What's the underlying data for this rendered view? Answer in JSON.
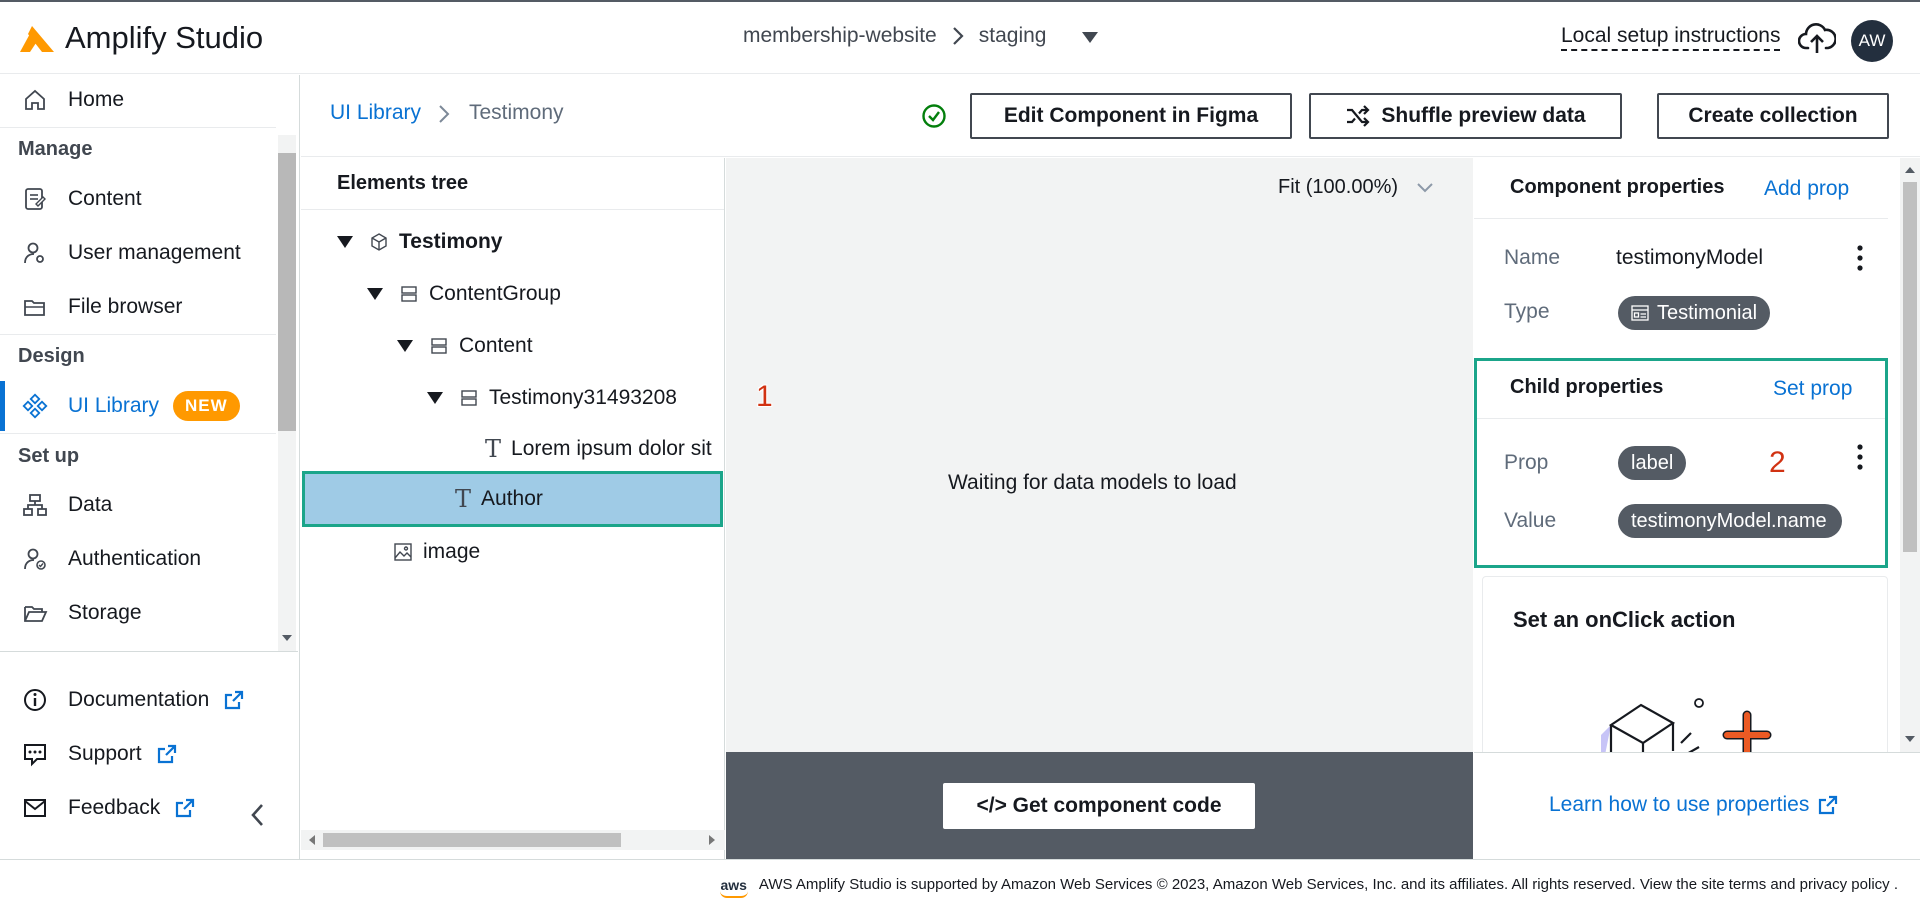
{
  "header": {
    "app_title": "Amplify Studio",
    "project": "membership-website",
    "environment": "staging",
    "setup_link": "Local setup instructions",
    "avatar_initials": "AW"
  },
  "sidebar": {
    "home": "Home",
    "sections": {
      "manage": "Manage",
      "design": "Design",
      "setup": "Set up"
    },
    "manage_items": [
      "Content",
      "User management",
      "File browser"
    ],
    "design_items": [
      {
        "label": "UI Library",
        "badge": "NEW"
      }
    ],
    "setup_items": [
      "Data",
      "Authentication",
      "Storage"
    ],
    "bottom_items": [
      "Documentation",
      "Support",
      "Feedback"
    ]
  },
  "breadcrumb": {
    "root": "UI Library",
    "current": "Testimony"
  },
  "toolbar": {
    "edit_figma": "Edit Component in Figma",
    "shuffle": "Shuffle preview data",
    "create_collection": "Create collection"
  },
  "tree": {
    "title": "Elements tree",
    "nodes": [
      {
        "label": "Testimony",
        "icon": "cube-icon"
      },
      {
        "label": "ContentGroup",
        "icon": "flex-icon"
      },
      {
        "label": "Content",
        "icon": "flex-icon"
      },
      {
        "label": "Testimony31493208",
        "icon": "flex-icon"
      },
      {
        "label": "Lorem ipsum dolor sit",
        "icon": "text-icon"
      },
      {
        "label": "Author",
        "icon": "text-icon"
      },
      {
        "label": "image",
        "icon": "image-icon"
      }
    ]
  },
  "preview": {
    "zoom": "Fit (100.00%)",
    "status": "Waiting for data models to load",
    "marker_1": "1",
    "get_code": "</> Get component code"
  },
  "component_properties": {
    "title": "Component properties",
    "add_prop": "Add prop",
    "name_label": "Name",
    "name_value": "testimonyModel",
    "type_label": "Type",
    "type_value": "Testimonial"
  },
  "child_properties": {
    "title": "Child properties",
    "set_prop": "Set prop",
    "prop_label": "Prop",
    "prop_value": "label",
    "value_label": "Value",
    "value_value": "testimonyModel.name",
    "marker_2": "2"
  },
  "onclick": {
    "title": "Set an onClick action"
  },
  "learn_link": "Learn how to use properties",
  "footer": {
    "aws": "aws",
    "text": "AWS Amplify Studio is supported by Amazon Web Services © 2023, Amazon Web Services, Inc. and its affiliates. All rights reserved. View the site terms and privacy policy ."
  },
  "colors": {
    "accent": "#0972d3",
    "brand_orange": "#ff9900",
    "highlight_teal": "#1ba58a",
    "selected_row": "#9fcbe6",
    "marker_red": "#d13212"
  }
}
